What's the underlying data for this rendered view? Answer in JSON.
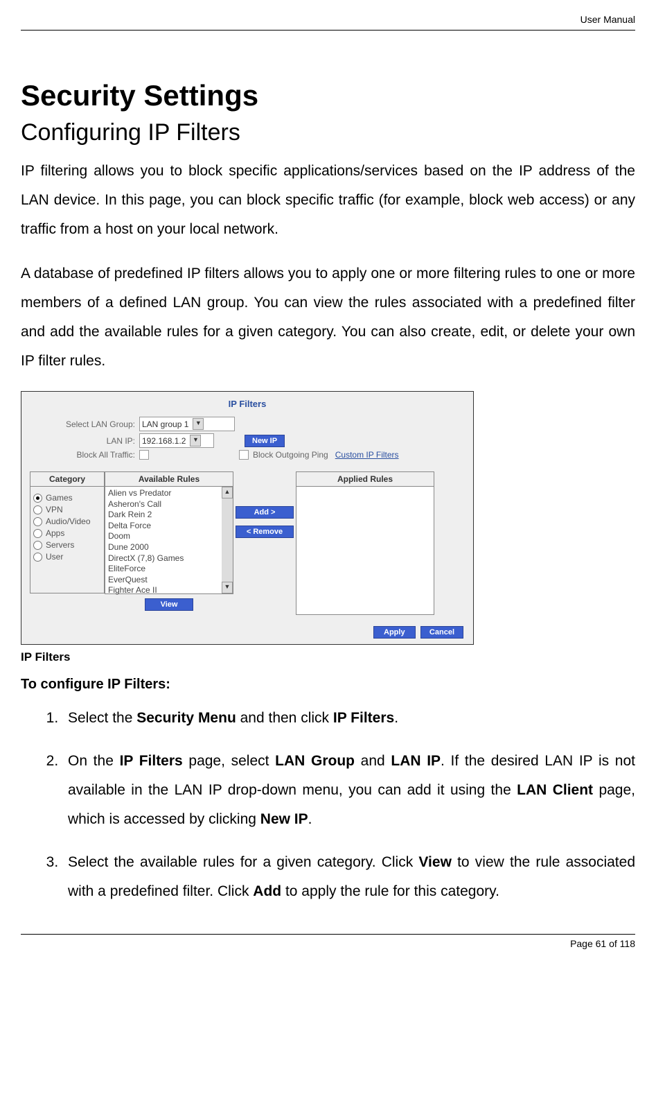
{
  "header": {
    "label": "User Manual"
  },
  "footer": {
    "label": "Page 61 of 118"
  },
  "title": "Security Settings",
  "subtitle": "Configuring IP Filters",
  "para1": "IP filtering allows you to block specific applications/services based on the IP address of the LAN device. In this page, you can block specific traffic (for example, block web access) or any traffic from a host on your local network.",
  "para2": "A database of predefined IP filters allows you to apply one or more filtering rules to one or more members of a defined LAN group. You can view the rules associated with a predefined filter and add the available rules for a given category. You can also create, edit, or delete your own IP filter rules.",
  "screenshot": {
    "title": "IP Filters",
    "labels": {
      "select_lan_group": "Select LAN Group:",
      "lan_ip": "LAN IP:",
      "block_all": "Block All Traffic:",
      "block_ping": "Block Outgoing Ping",
      "custom_link": "Custom IP Filters"
    },
    "values": {
      "lan_group": "LAN group 1",
      "lan_ip": "192.168.1.2"
    },
    "buttons": {
      "new_ip": "New IP",
      "add": "Add >",
      "remove": "< Remove",
      "view": "View",
      "apply": "Apply",
      "cancel": "Cancel"
    },
    "category_header": "Category",
    "available_header": "Available Rules",
    "applied_header": "Applied Rules",
    "categories": [
      "Games",
      "VPN",
      "Audio/Video",
      "Apps",
      "Servers",
      "User"
    ],
    "available_rules": [
      "Alien vs Predator",
      "Asheron's Call",
      "Dark Rein 2",
      "Delta Force",
      "Doom",
      "Dune 2000",
      "DirectX (7,8) Games",
      "EliteForce",
      "EverQuest",
      "Fighter Ace II"
    ]
  },
  "caption": "IP Filters",
  "steps_title": "To configure IP Filters:",
  "steps": {
    "s1_a": "Select the ",
    "s1_b": "Security Menu",
    "s1_c": " and then click ",
    "s1_d": "IP Filters",
    "s1_e": ".",
    "s2_a": "On the ",
    "s2_b": "IP Filters",
    "s2_c": " page, select ",
    "s2_d": "LAN Group",
    "s2_e": " and ",
    "s2_f": "LAN IP",
    "s2_g": ". If the desired LAN IP is not available in the LAN IP drop-down menu, you can add it using the ",
    "s2_h": "LAN Client",
    "s2_i": " page, which is accessed by clicking ",
    "s2_j": "New IP",
    "s2_k": ".",
    "s3_a": "Select the available rules for a given category. Click ",
    "s3_b": "View",
    "s3_c": " to view the rule associated with a predefined filter. Click ",
    "s3_d": "Add",
    "s3_e": " to apply the rule for this category."
  }
}
